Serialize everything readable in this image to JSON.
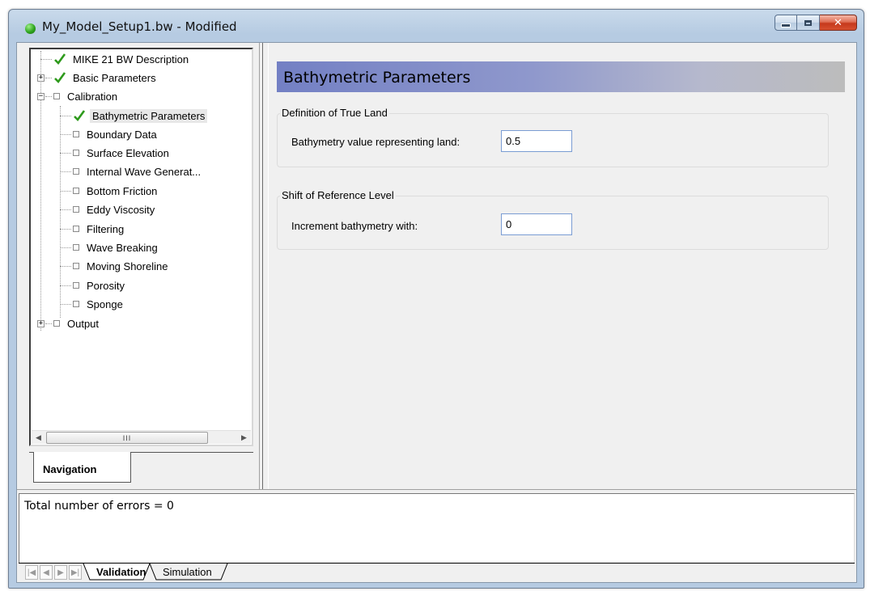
{
  "window": {
    "title": "My_Model_Setup1.bw - Modified",
    "minimize_glyph": "",
    "close_glyph": "✕"
  },
  "tree": {
    "items": [
      {
        "label": "MIKE 21 BW Description",
        "icon": "check-icon"
      },
      {
        "label": "Basic Parameters",
        "icon": "check-icon"
      },
      {
        "label": "Calibration",
        "icon": "box-icon"
      },
      {
        "label": "Bathymetric Parameters",
        "icon": "check-icon"
      },
      {
        "label": "Boundary Data",
        "icon": "box-icon"
      },
      {
        "label": "Surface Elevation",
        "icon": "box-icon"
      },
      {
        "label": "Internal Wave Generat...",
        "icon": "box-icon"
      },
      {
        "label": "Bottom Friction",
        "icon": "box-icon"
      },
      {
        "label": "Eddy Viscosity",
        "icon": "box-icon"
      },
      {
        "label": "Filtering",
        "icon": "box-icon"
      },
      {
        "label": "Wave Breaking",
        "icon": "box-icon"
      },
      {
        "label": "Moving Shoreline",
        "icon": "box-icon"
      },
      {
        "label": "Porosity",
        "icon": "box-icon"
      },
      {
        "label": "Sponge",
        "icon": "box-icon"
      },
      {
        "label": "Output",
        "icon": "box-icon"
      }
    ],
    "scroll_thumb_grip": "III"
  },
  "nav_tab": {
    "label": "Navigation"
  },
  "main": {
    "title": "Bathymetric Parameters",
    "groups": [
      {
        "legend": "Definition of True Land",
        "field_label": "Bathymetry value representing land:",
        "value": "0.5"
      },
      {
        "legend": "Shift of Reference Level",
        "field_label": "Increment bathymetry with:",
        "value": "0"
      }
    ]
  },
  "output": {
    "text": "Total number of errors = 0",
    "tabs": [
      "Validation",
      "Simulation"
    ]
  },
  "colors": {
    "check": "#2e9a1c",
    "header_start": "#7380c4",
    "header_end": "#bcbcbc"
  }
}
